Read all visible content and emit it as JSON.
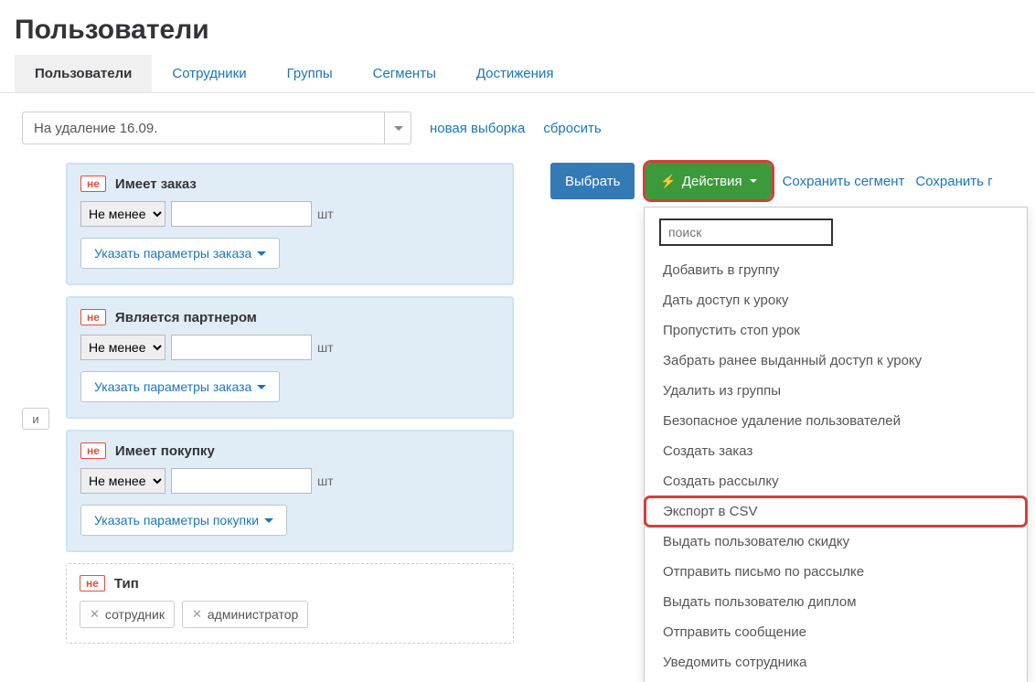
{
  "page_title": "Пользователи",
  "tabs": [
    {
      "label": "Пользователи",
      "active": true
    },
    {
      "label": "Сотрудники"
    },
    {
      "label": "Группы"
    },
    {
      "label": "Сегменты"
    },
    {
      "label": "Достижения"
    }
  ],
  "filter_select": {
    "value": "На удаление 16.09."
  },
  "filter_links": {
    "new": "новая выборка",
    "reset": "сбросить"
  },
  "and_label": "и",
  "neg_label": "не",
  "select_option": "Не менее",
  "unit_label": "шт",
  "param_order_btn": "Указать параметры заказа",
  "param_purchase_btn": "Указать параметры покупки",
  "cards": {
    "c1_title": "Имеет заказ",
    "c2_title": "Является партнером",
    "c3_title": "Имеет покупку",
    "c4_title": "Тип",
    "c4_tags": [
      "сотрудник",
      "администратор"
    ]
  },
  "actions": {
    "select": "Выбрать",
    "actions_btn": "Действия",
    "save_segment": "Сохранить сегмент",
    "save_partial": "Сохранить г"
  },
  "dropdown": {
    "search_placeholder": "поиск",
    "items": [
      "Добавить в группу",
      "Дать доступ к уроку",
      "Пропустить стоп урок",
      "Забрать ранее выданный доступ к уроку",
      "Удалить из группы",
      "Безопасное удаление пользователей",
      "Создать заказ",
      "Создать рассылку",
      "Экспорт в CSV",
      "Выдать пользователю скидку",
      "Отправить письмо по рассылке",
      "Выдать пользователю диплом",
      "Отправить сообщение",
      "Уведомить сотрудника"
    ],
    "highlight_index": 8
  }
}
